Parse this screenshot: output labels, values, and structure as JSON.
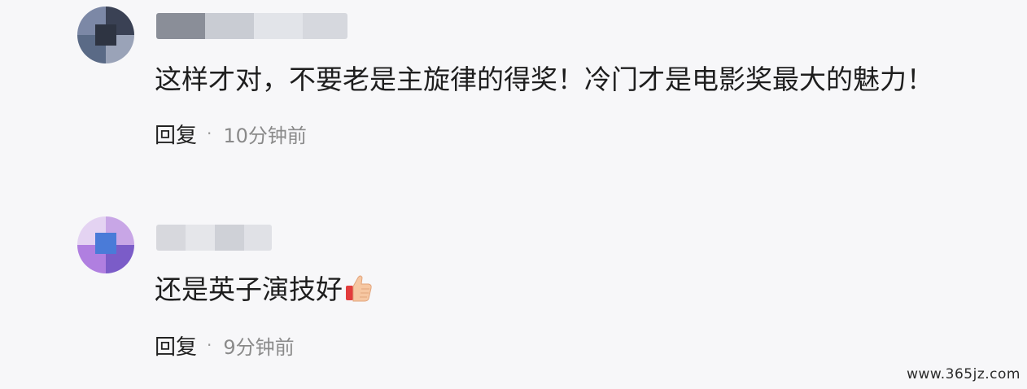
{
  "comments": [
    {
      "text": "这样才对，不要老是主旋律的得奖！冷门才是电影奖最大的魅力！",
      "reply_label": "回复",
      "separator": "·",
      "time": "10分钟前",
      "avatar_colors": [
        "#5a6a86",
        "#3a4154",
        "#7c88a6",
        "#9aa3b8",
        "#2e3442"
      ],
      "username_colors": [
        "#8a8e98",
        "#c9ccd3",
        "#e2e4e9",
        "#d6d8de"
      ]
    },
    {
      "text": "还是英子演技好",
      "emoji": "thumbs-up-icon",
      "reply_label": "回复",
      "separator": "·",
      "time": "9分钟前",
      "avatar_colors": [
        "#c8a6e6",
        "#4a7bd8",
        "#b07fe0",
        "#e4d3f2",
        "#7b5cc8"
      ],
      "username_colors": [
        "#d7d8dd",
        "#e5e6ea",
        "#cfd1d7",
        "#e0e1e6"
      ]
    }
  ],
  "watermark": "www.365jz.com"
}
